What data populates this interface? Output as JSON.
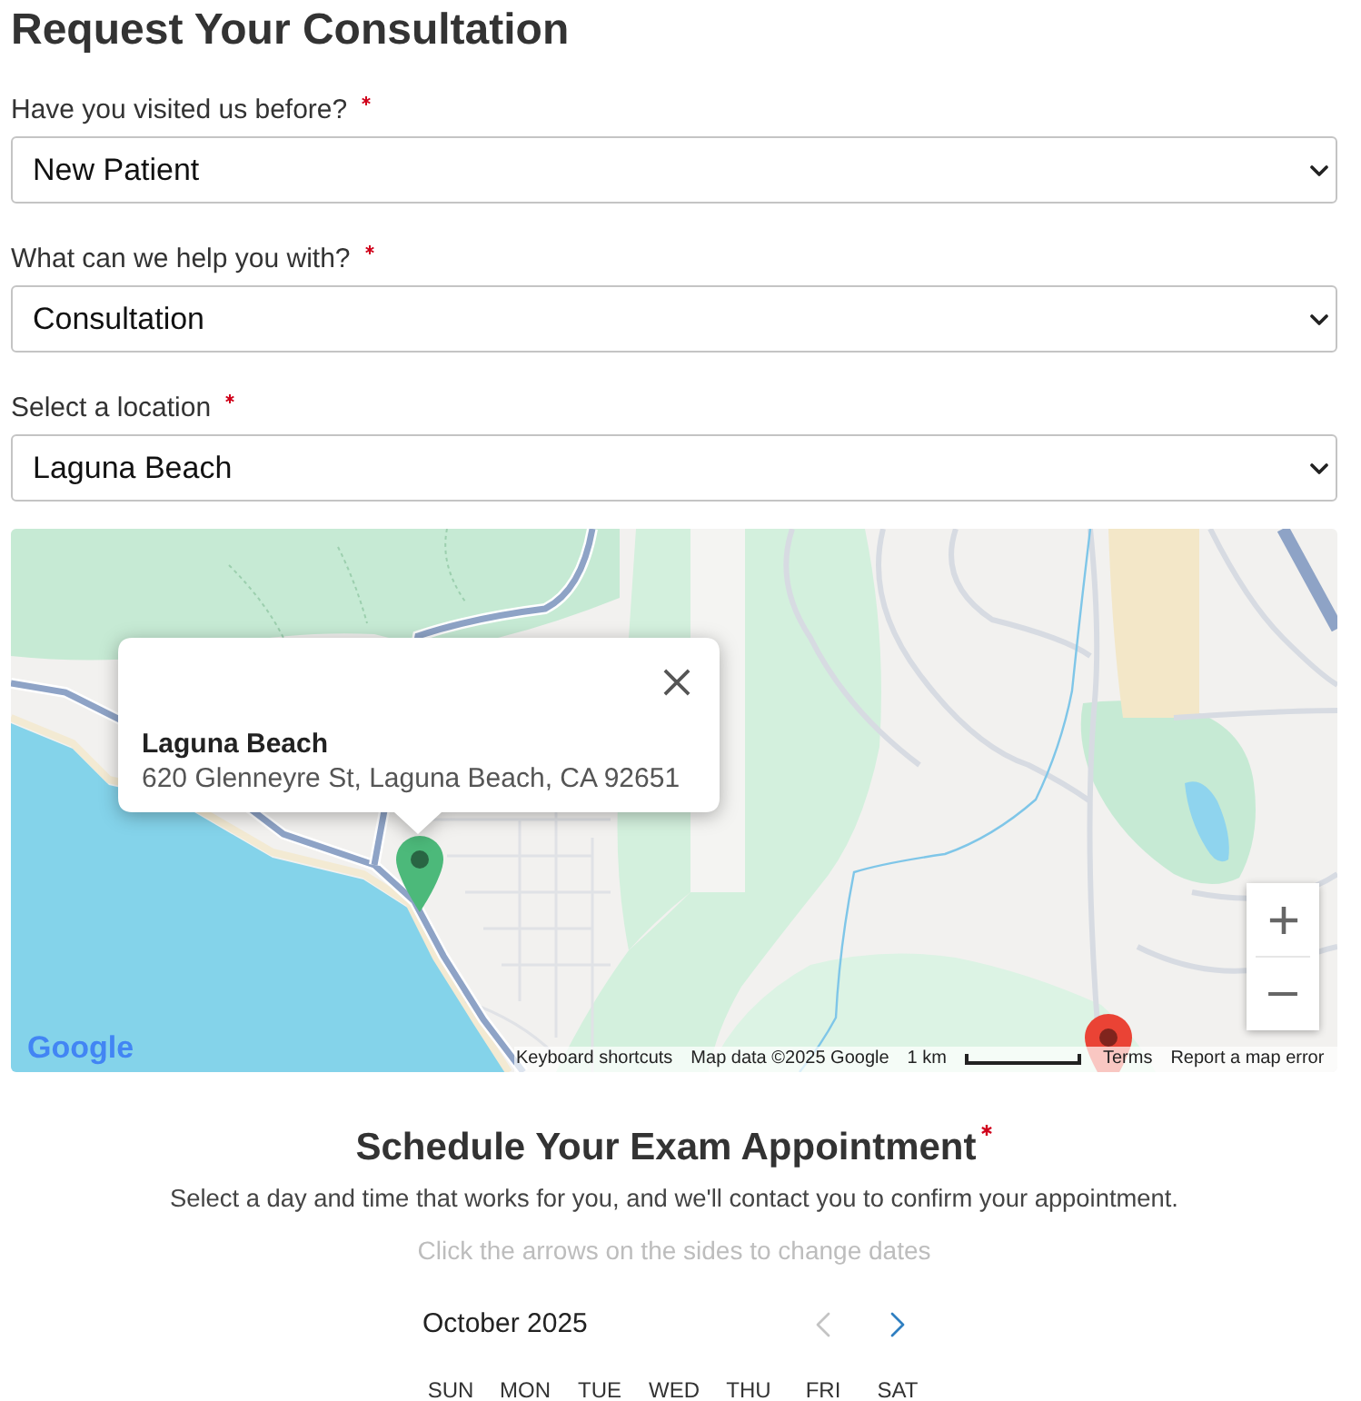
{
  "title": "Request Your Consultation",
  "fields": [
    {
      "label": "Have you visited us before?",
      "required": true,
      "value": "New Patient"
    },
    {
      "label": "What can we help you with?",
      "required": true,
      "value": "Consultation"
    },
    {
      "label": "Select a location",
      "required": true,
      "value": "Laguna Beach"
    }
  ],
  "map": {
    "info_window": {
      "title": "Laguna Beach",
      "address": "620 Glenneyre St, Laguna Beach, CA 92651"
    },
    "markers": [
      {
        "color": "#4cb97a"
      },
      {
        "color": "#ea4335"
      }
    ],
    "logo": "Google",
    "footer": {
      "shortcuts": "Keyboard shortcuts",
      "map_data": "Map data ©2025 Google",
      "scale": "1 km",
      "terms": "Terms",
      "report": "Report a map error"
    }
  },
  "schedule": {
    "title": "Schedule Your Exam Appointment",
    "required": true,
    "subtitle": "Select a day and time that works for you, and we'll contact you to confirm your appointment.",
    "hint": "Click the arrows on the sides to change dates",
    "calendar": {
      "month": "October 2025",
      "prev": {
        "disabled": true
      },
      "next": {
        "disabled": false
      },
      "weekdays": [
        "SUN",
        "MON",
        "TUE",
        "WED",
        "THU",
        "FRI",
        "SAT"
      ]
    }
  }
}
